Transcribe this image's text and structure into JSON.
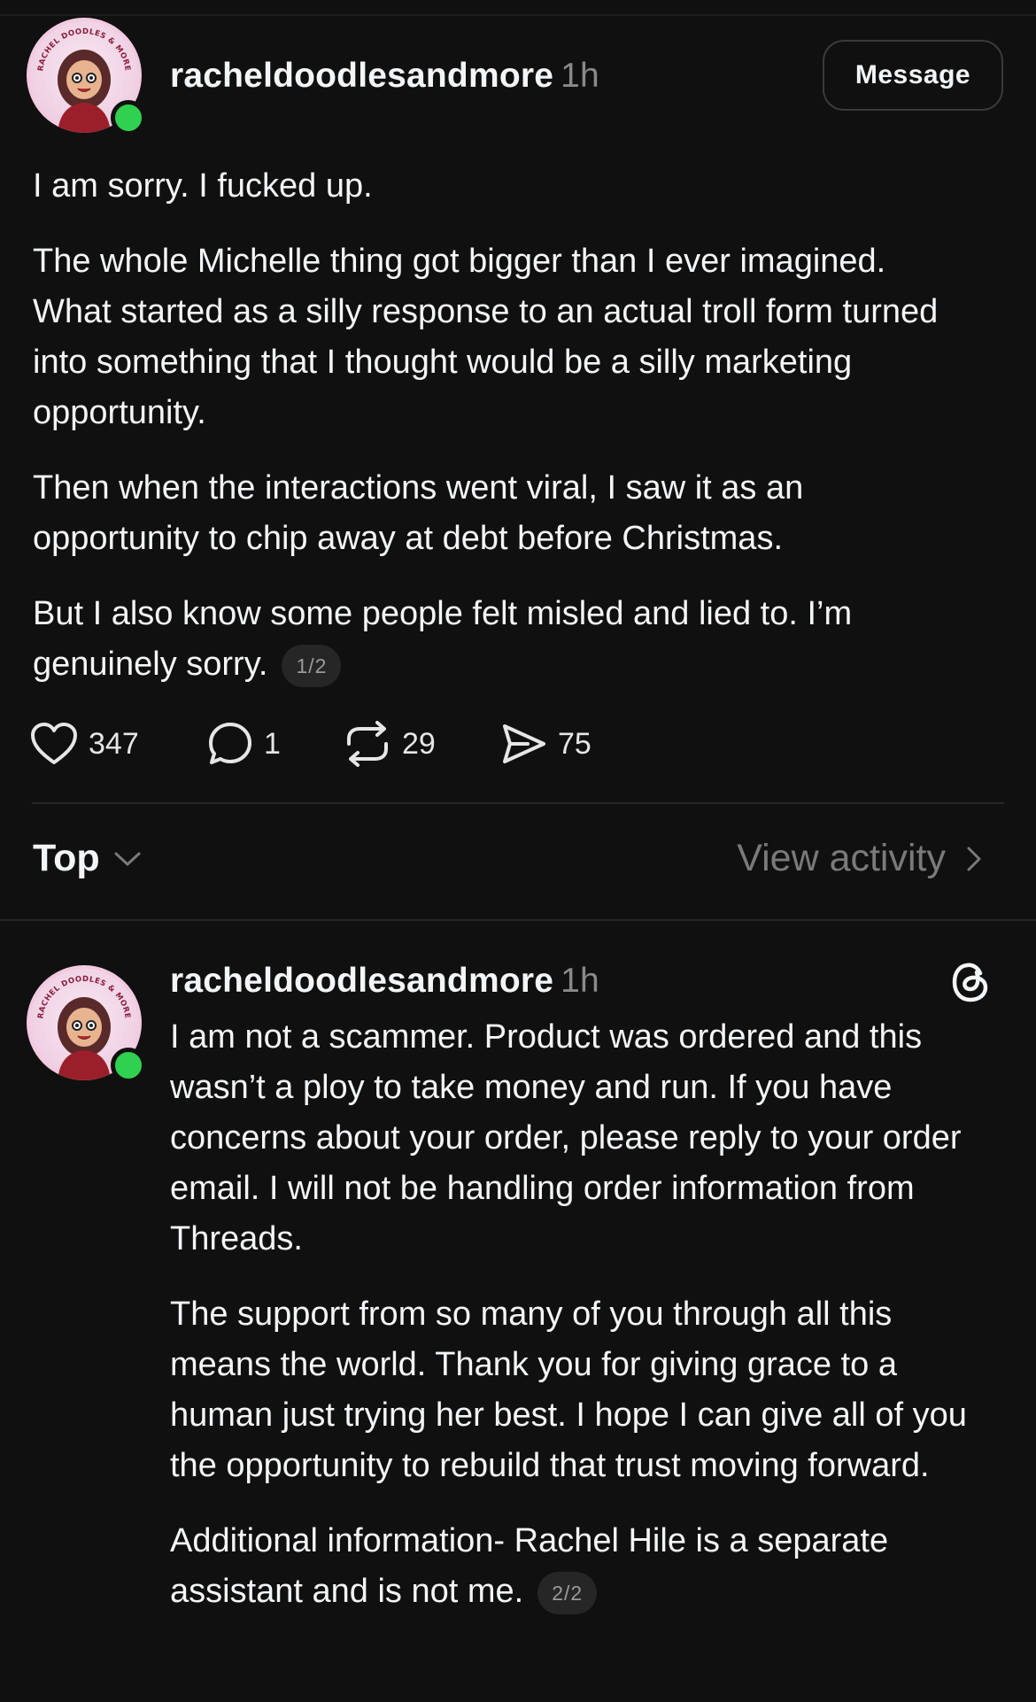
{
  "post1": {
    "username": "racheldoodlesandmore",
    "time": "1h",
    "message_button": "Message",
    "paragraphs": [
      "I am sorry. I fucked up.",
      "The whole Michelle thing got bigger than I ever imagined. What started as a silly response to an actual troll form turned into something that I thought would be a silly marketing opportunity.",
      "Then when the interactions went viral, I saw it as an opportunity to chip away at debt before Christmas.",
      "But I also know some people felt misled and lied to. I’m genuinely sorry."
    ],
    "pager": "1/2",
    "actions": {
      "likes": "347",
      "replies": "1",
      "reposts": "29",
      "shares": "75"
    }
  },
  "sort": {
    "label": "Top",
    "view_activity": "View activity"
  },
  "post2": {
    "username": "racheldoodlesandmore",
    "time": "1h",
    "paragraphs": [
      "I am not a scammer. Product was ordered and this wasn’t a ploy to take money and run. If you have concerns about your order, please reply to your order email. I will not be handling order information from Threads.",
      "The support from so many of you through all this means the world. Thank you for giving grace to a human just trying her best. I hope I can give all of you the opportunity to rebuild that trust moving forward.",
      "Additional information- Rachel Hile is a separate assistant and is not me."
    ],
    "pager": "2/2"
  },
  "avatar_badge_text": "RACHEL DOODLES & MORE",
  "colors": {
    "background": "#101010",
    "text": "#f3f5f7",
    "muted": "#8a8a8a",
    "online": "#2fd14f"
  }
}
